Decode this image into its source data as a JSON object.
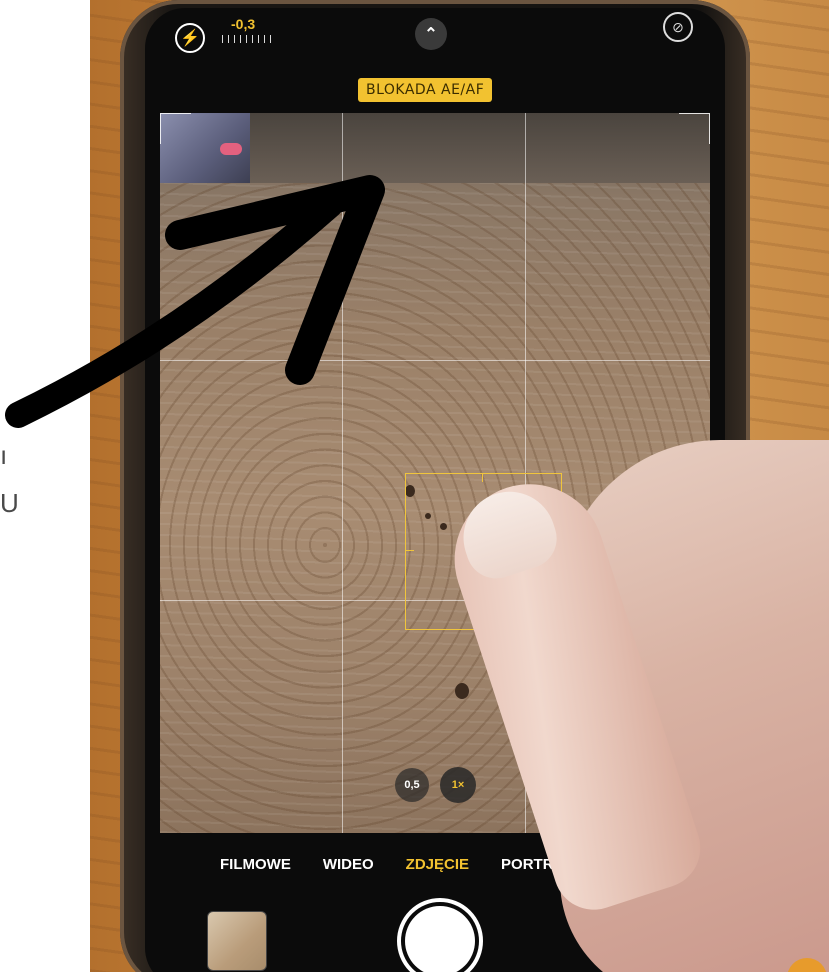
{
  "top_bar": {
    "exposure_value": "-0,3",
    "lock_badge": "BLOKADA AE/AF"
  },
  "zoom": {
    "wide_label": "0,5",
    "standard_label": "1×"
  },
  "modes": [
    {
      "label": "FILMOWE",
      "active": false
    },
    {
      "label": "WIDEO",
      "active": false
    },
    {
      "label": "ZDJĘCIE",
      "active": true
    },
    {
      "label": "PORTRET",
      "active": false
    }
  ],
  "side_text": {
    "line1": "ı",
    "line2": "U"
  },
  "colors": {
    "accent": "#f2c230",
    "arrow": "#000000"
  },
  "icons": {
    "flash": "flash-icon",
    "chevron": "chevron-up-icon",
    "live_photo": "live-photo-off-icon"
  }
}
